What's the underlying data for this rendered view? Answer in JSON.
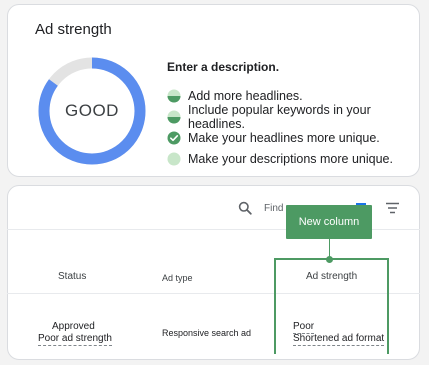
{
  "ad_strength": {
    "title": "Ad strength",
    "rating": "GOOD",
    "rating_fraction": 0.85,
    "gauge_color": "#5b8def",
    "gauge_track_color": "#e3e3e3",
    "suggestions_heading": "Enter a description.",
    "suggestions": [
      {
        "text": "Add more headlines.",
        "icon": "half-filled-circle-icon"
      },
      {
        "text": "Include popular keywords in your headlines.",
        "icon": "half-filled-circle-icon"
      },
      {
        "text": "Make your headlines more unique.",
        "icon": "checkmark-circle-icon"
      },
      {
        "text": "Make your descriptions more unique.",
        "icon": "empty-circle-icon"
      }
    ]
  },
  "table": {
    "search_placeholder": "Find a",
    "callout_label": "New column",
    "accent_color": "#4d9a63",
    "columns": [
      "Status",
      "Ad type",
      "Ad strength"
    ],
    "rows": [
      {
        "status": "Approved",
        "status_detail": "Poor ad strength",
        "ad_type": "Responsive search ad",
        "ad_strength": "Poor",
        "ad_strength_detail": "Shortened ad format"
      }
    ]
  }
}
